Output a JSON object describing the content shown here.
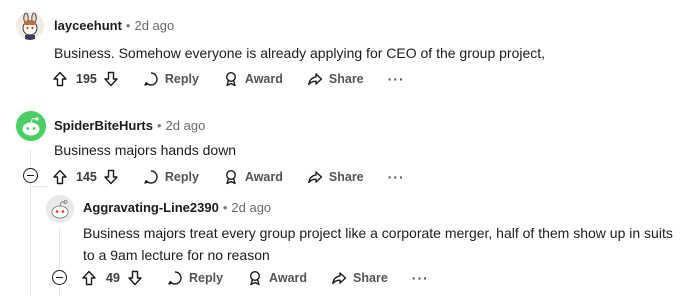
{
  "comments": [
    {
      "author": "layceehunt",
      "separator": "•",
      "time": "2d ago",
      "body": "Business. Somehow everyone is already applying for CEO of the group project,",
      "votes": "195",
      "reply_label": "Reply",
      "award_label": "Award",
      "share_label": "Share",
      "more_label": "···"
    },
    {
      "author": "SpiderBiteHurts",
      "separator": "•",
      "time": "2d ago",
      "body": "Business majors hands down",
      "votes": "145",
      "reply_label": "Reply",
      "award_label": "Award",
      "share_label": "Share",
      "more_label": "···"
    },
    {
      "author": "Aggravating-Line2390",
      "separator": "•",
      "time": "2d ago",
      "body": "Business majors treat every group project like a corporate merger, half of them show up in suits to a 9am lecture for no reason",
      "votes": "49",
      "reply_label": "Reply",
      "award_label": "Award",
      "share_label": "Share",
      "more_label": "···"
    }
  ],
  "colors": {
    "avatar_green": "#46d160",
    "text": "#1c1c1c",
    "muted": "#6a6a6a",
    "thread_line": "#e5e5e5"
  }
}
